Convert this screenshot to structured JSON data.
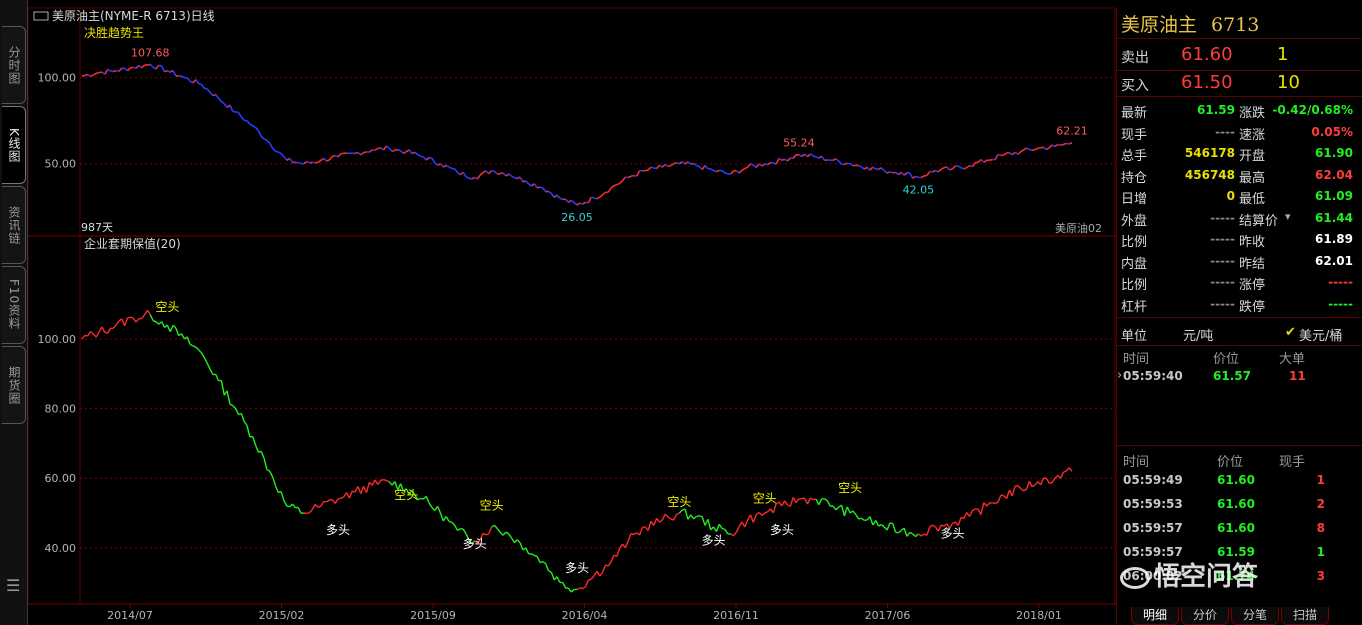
{
  "left_tabs": [
    {
      "label": "分时图",
      "active": false
    },
    {
      "label": "K线图",
      "active": true
    },
    {
      "label": "资讯链",
      "active": false
    },
    {
      "label": "F10资料",
      "active": false
    },
    {
      "label": "期货圈",
      "active": false
    }
  ],
  "chart_header": {
    "title": "美原油主(NYME-R 6713)日线",
    "upper_indicator": "决胜趋势王",
    "lower_indicator": "企业套期保值(20)",
    "days_label": "987天",
    "contract_label": "美原油02"
  },
  "colors": {
    "up": "#ff2a2a",
    "down": "#2a3cff",
    "green": "#22ee22",
    "yellow_label": "#f0f000",
    "grid": "#7a0000"
  },
  "chart_data": [
    {
      "type": "line",
      "title": "决胜趋势王",
      "x_ticks": [
        "2014/07",
        "2015/02",
        "2015/09",
        "2016/04",
        "2016/11",
        "2017/06",
        "2018/01"
      ],
      "y_ticks": [
        "100.00",
        "50.00"
      ],
      "ylim": [
        15,
        130
      ],
      "series": [
        {
          "values": [
            101,
            103,
            104,
            106,
            107.68,
            104,
            100,
            96,
            88,
            80,
            72,
            62,
            52,
            50,
            52,
            54,
            56,
            58,
            59,
            57,
            54,
            50,
            45,
            42,
            46,
            44,
            40,
            36,
            30,
            26.05,
            30,
            36,
            42,
            46,
            48,
            50,
            49,
            46,
            44,
            48,
            50,
            52,
            55.24,
            54,
            52,
            50,
            48,
            46,
            45,
            42.05,
            46,
            47,
            49,
            52,
            55,
            57,
            59,
            60,
            62.21
          ]
        }
      ],
      "annotations": [
        {
          "text": "107.68",
          "x_index": 4,
          "y": 107.68,
          "color": "#ff5a5a"
        },
        {
          "text": "26.05",
          "x_index": 29,
          "y": 26.05,
          "color": "#37d0d0"
        },
        {
          "text": "55.24",
          "x_index": 42,
          "y": 55.24,
          "color": "#ff5a5a"
        },
        {
          "text": "42.05",
          "x_index": 49,
          "y": 42.05,
          "color": "#37d0d0"
        },
        {
          "text": "62.21",
          "x_index": 58,
          "y": 62.21,
          "color": "#ff5a5a"
        }
      ]
    },
    {
      "type": "line",
      "title": "企业套期保值(20)",
      "y_ticks": [
        "100.00",
        "80.00",
        "60.00",
        "40.00"
      ],
      "ylim": [
        25,
        125
      ],
      "series": [
        {
          "values": [
            100,
            102,
            104,
            106,
            107,
            104,
            100,
            96,
            88,
            80,
            72,
            62,
            52,
            50,
            52,
            54,
            56,
            58,
            59,
            57,
            54,
            50,
            45,
            42,
            46,
            44,
            40,
            36,
            30,
            28,
            32,
            36,
            42,
            46,
            48,
            50,
            49,
            46,
            44,
            48,
            50,
            52,
            54,
            54,
            52,
            50,
            48,
            46,
            45,
            44,
            46,
            47,
            49,
            52,
            55,
            57,
            59,
            60,
            62
          ]
        }
      ],
      "signals": [
        {
          "text": "空头",
          "x_index": 5,
          "y": 108
        },
        {
          "text": "多头",
          "x_index": 15,
          "y": 44
        },
        {
          "text": "空头",
          "x_index": 19,
          "y": 54
        },
        {
          "text": "多头",
          "x_index": 23,
          "y": 40
        },
        {
          "text": "空头",
          "x_index": 24,
          "y": 51
        },
        {
          "text": "多头",
          "x_index": 29,
          "y": 33
        },
        {
          "text": "空头",
          "x_index": 35,
          "y": 52
        },
        {
          "text": "多头",
          "x_index": 37,
          "y": 41
        },
        {
          "text": "空头",
          "x_index": 40,
          "y": 53
        },
        {
          "text": "多头",
          "x_index": 41,
          "y": 44
        },
        {
          "text": "空头",
          "x_index": 45,
          "y": 56
        },
        {
          "text": "多头",
          "x_index": 51,
          "y": 43
        }
      ]
    }
  ],
  "panel": {
    "name": "美原油主",
    "code": "6713",
    "sell": {
      "label": "卖出",
      "price": "61.60",
      "vol": "1"
    },
    "buy": {
      "label": "买入",
      "price": "61.50",
      "vol": "10"
    },
    "stats_left": [
      {
        "k": "最新",
        "v": "61.59",
        "color": "#22ee22"
      },
      {
        "k": "现手",
        "v": "----",
        "color": "#888888"
      },
      {
        "k": "总手",
        "v": "546178",
        "color": "#e8e000"
      },
      {
        "k": "持仓",
        "v": "456748",
        "color": "#e8e000"
      },
      {
        "k": "日增",
        "v": "0",
        "color": "#e8e000"
      },
      {
        "k": "外盘",
        "v": "-----",
        "color": "#888888"
      },
      {
        "k": "比例",
        "v": "-----",
        "color": "#888888"
      },
      {
        "k": "内盘",
        "v": "-----",
        "color": "#888888"
      },
      {
        "k": "比例",
        "v": "-----",
        "color": "#888888"
      },
      {
        "k": "杠杆",
        "v": "-----",
        "color": "#888888"
      }
    ],
    "stats_right": [
      {
        "k": "涨跌",
        "v": "-0.42/0.68%",
        "color": "#22ee22"
      },
      {
        "k": "速涨",
        "v": "0.05%",
        "color": "#ff3c3c"
      },
      {
        "k": "开盘",
        "v": "61.90",
        "color": "#22ee22"
      },
      {
        "k": "最高",
        "v": "62.04",
        "color": "#ff3c3c"
      },
      {
        "k": "最低",
        "v": "61.09",
        "color": "#22ee22"
      },
      {
        "k": "结算价",
        "v": "61.44",
        "color": "#22ee22"
      },
      {
        "k": "昨收",
        "v": "61.89",
        "color": "#ffffff"
      },
      {
        "k": "昨结",
        "v": "62.01",
        "color": "#ffffff"
      },
      {
        "k": "涨停",
        "v": "-----",
        "color": "#ff3c3c"
      },
      {
        "k": "跌停",
        "v": "-----",
        "color": "#22ee22"
      }
    ],
    "unit_label": "单位",
    "unit_option_a": "元/吨",
    "unit_option_b": "美元/桶",
    "big_trades": {
      "headers": [
        "时间",
        "价位",
        "大单"
      ],
      "rows": [
        {
          "time": "05:59:40",
          "price": "61.57",
          "vol": "11"
        }
      ]
    },
    "ticks": {
      "headers": [
        "时间",
        "价位",
        "现手"
      ],
      "rows": [
        {
          "time": "05:59:49",
          "price": "61.60",
          "vol": "1",
          "pcolor": "#22ee22",
          "vcolor": "#ff3c3c"
        },
        {
          "time": "05:59:53",
          "price": "61.60",
          "vol": "2",
          "pcolor": "#22ee22",
          "vcolor": "#ff3c3c"
        },
        {
          "time": "05:59:57",
          "price": "61.60",
          "vol": "8",
          "pcolor": "#22ee22",
          "vcolor": "#ff3c3c"
        },
        {
          "time": "05:59:57",
          "price": "61.59",
          "vol": "1",
          "pcolor": "#22ee22",
          "vcolor": "#22ee22"
        },
        {
          "time": "06:00:02",
          "price": "61.74",
          "vol": "3",
          "pcolor": "#22ee22",
          "vcolor": "#ff3c3c"
        }
      ]
    },
    "bottom_tabs": [
      "明细",
      "分价",
      "分笔",
      "扫描"
    ],
    "watermark": "悟空问答"
  }
}
